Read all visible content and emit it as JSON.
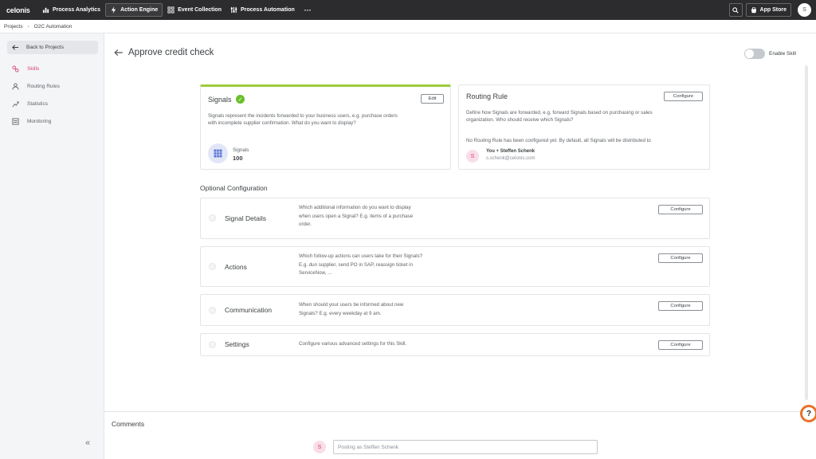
{
  "topbar": {
    "logo": "celonis",
    "nav": [
      {
        "label": "Process Analytics",
        "icon": "chart-icon"
      },
      {
        "label": "Action Engine",
        "icon": "lightning-icon"
      },
      {
        "label": "Event Collection",
        "icon": "collection-icon"
      },
      {
        "label": "Process Automation",
        "icon": "automation-icon"
      }
    ],
    "more": "···",
    "app_store": "App Store",
    "avatar": "S"
  },
  "breadcrumb": {
    "root": "Projects",
    "separator": "›",
    "current": "O2C Automation"
  },
  "sidebar": {
    "back": "Back to Projects",
    "items": [
      {
        "label": "Skills",
        "icon": "skills-icon"
      },
      {
        "label": "Routing Rules",
        "icon": "user-icon"
      },
      {
        "label": "Statistics",
        "icon": "statistics-icon"
      },
      {
        "label": "Monitoring",
        "icon": "monitoring-icon"
      }
    ],
    "collapse": "«"
  },
  "header": {
    "title": "Approve credit check",
    "toggle_label": "Enable Skill"
  },
  "signals": {
    "title": "Signals",
    "edit": "Edit",
    "desc1": "Signals represent the incidents forwarded to your business users, e.g. purchase orders",
    "desc2": "with incomplete supplier confirmation. What do you want to display?",
    "stat_label": "Signals",
    "stat_value": "100"
  },
  "routing": {
    "title": "Routing Rule",
    "configure": "Configure",
    "desc1": "Define how Signals are forwarded, e.g. forward Signals based on purchasing or sales",
    "desc2": "organization. Who should receive which Signals?",
    "note": "No Routing Rule has been configured yet. By default, all Signals will be distributed to",
    "avatar": "S",
    "user": "You + Steffen Schenk",
    "email": "s.schenk@celonis.com"
  },
  "optional": {
    "title": "Optional Configuration",
    "items": [
      {
        "name": "Signal Details",
        "lines": [
          "Which additional information do you want to display",
          "when users open a Signal? E.g. items of a purchase",
          "order."
        ],
        "button": "Configure"
      },
      {
        "name": "Actions",
        "lines": [
          "Which follow-up actions can users take for their Signals?",
          "E.g. dun supplier, send PO in SAP, reassign ticket in",
          "ServiceNow, ..."
        ],
        "button": "Configure"
      },
      {
        "name": "Communication",
        "lines": [
          "When should your users be informed about new",
          "Signals? E.g. every weekday at 9 am."
        ],
        "button": "Configure"
      },
      {
        "name": "Settings",
        "lines": [
          "Configure various advanced settings for this Skill."
        ],
        "button": "Configure"
      }
    ]
  },
  "comments": {
    "title": "Comments",
    "avatar": "S",
    "placeholder": "Posting as Steffen Schenk"
  },
  "help": "?",
  "colors": {
    "accent": "#d8417a",
    "success": "#6abf2a",
    "progress": "#9ccc3a",
    "topbar": "#2c2c2e"
  }
}
